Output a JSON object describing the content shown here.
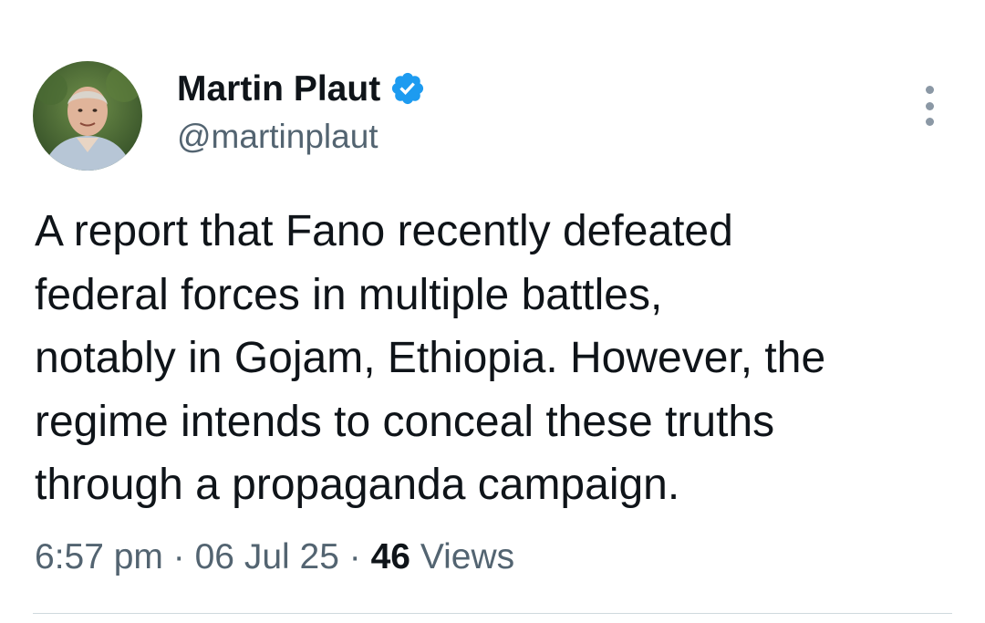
{
  "author": {
    "name": "Martin Plaut",
    "handle": "@martinplaut",
    "avatar_icon": "profile-photo",
    "verified_icon": "verified-badge-icon",
    "verified_color": "#1d9bf0"
  },
  "tweet": {
    "text": "A report that Fano recently defeated\nfederal forces in multiple battles,\nnotably in Gojam, Ethiopia. However, the\nregime intends to conceal these truths\nthrough a propaganda campaign."
  },
  "meta": {
    "time": "6:57 pm",
    "separator": "·",
    "date": "06 Jul 25",
    "views_count": "46",
    "views_label": "Views"
  },
  "menu": {
    "icon": "more-vertical-icon"
  },
  "colors": {
    "text_primary": "#0f1419",
    "text_secondary": "#536471",
    "accent": "#1d9bf0",
    "divider": "#cfd9de"
  }
}
